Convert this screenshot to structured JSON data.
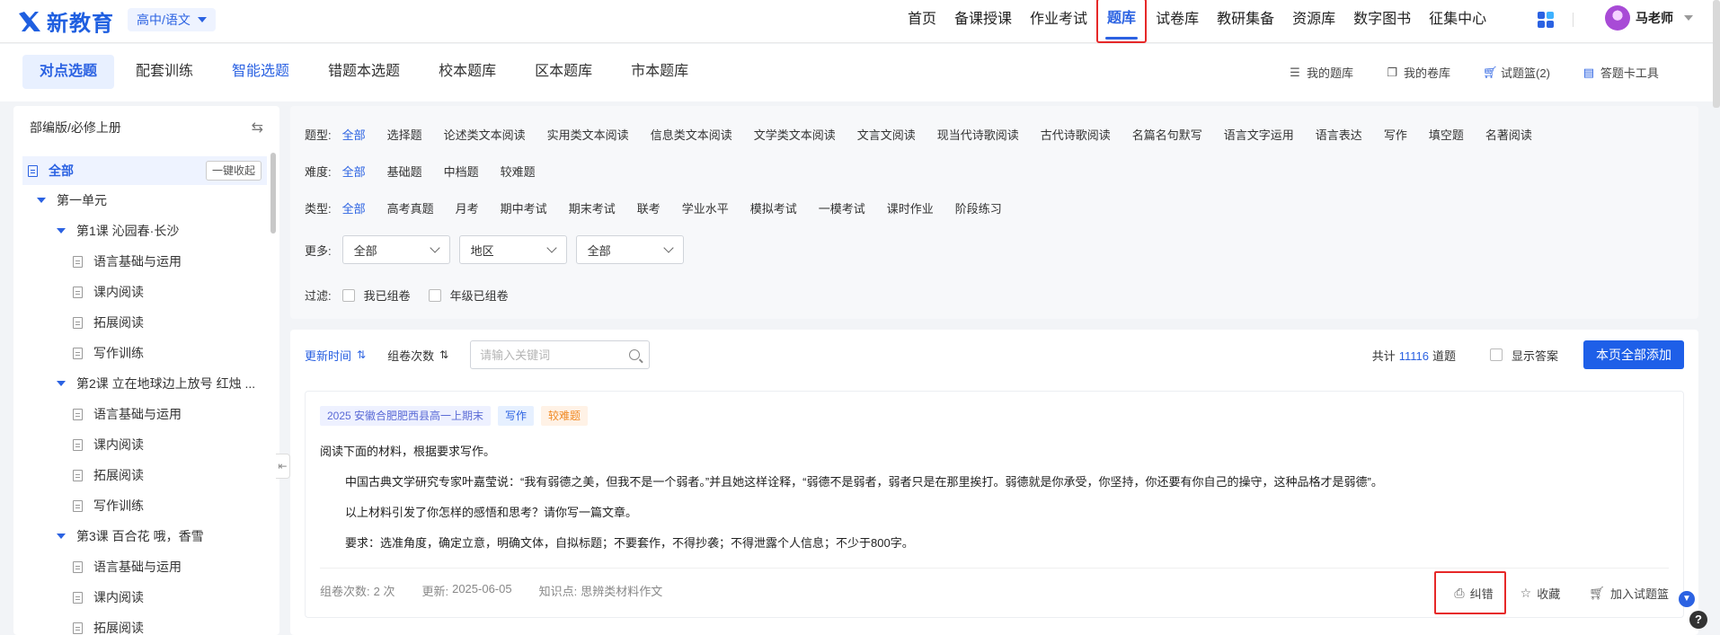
{
  "logo": {
    "text": "新教育"
  },
  "stage": {
    "label": "高中/语文"
  },
  "nav": {
    "items": [
      "首页",
      "备课授课",
      "作业考试",
      "题库",
      "试卷库",
      "教研集备",
      "资源库",
      "数字图书",
      "征集中心"
    ],
    "active_index": 3
  },
  "user": {
    "name": "马老师"
  },
  "subtabs": {
    "items": [
      "对点选题",
      "配套训练",
      "智能选题",
      "错题本选题",
      "校本题库",
      "区本题库",
      "市本题库"
    ],
    "active_index": 0
  },
  "tools": {
    "my_questions": "我的题库",
    "my_papers": "我的卷库",
    "basket": "试题篮(2)",
    "card_tool": "答题卡工具"
  },
  "sidebar": {
    "edition": "部编版/必修上册",
    "all_label": "全部",
    "collapse_all": "一键收起",
    "tree": [
      {
        "level": 0,
        "type": "unit",
        "label": "第一单元"
      },
      {
        "level": 1,
        "type": "lesson",
        "label": "第1课 沁园春·长沙"
      },
      {
        "level": 2,
        "type": "leaf",
        "label": "语言基础与运用"
      },
      {
        "level": 2,
        "type": "leaf",
        "label": "课内阅读"
      },
      {
        "level": 2,
        "type": "leaf",
        "label": "拓展阅读"
      },
      {
        "level": 2,
        "type": "leaf",
        "label": "写作训练"
      },
      {
        "level": 1,
        "type": "lesson",
        "label": "第2课 立在地球边上放号 红烛 ..."
      },
      {
        "level": 2,
        "type": "leaf",
        "label": "语言基础与运用"
      },
      {
        "level": 2,
        "type": "leaf",
        "label": "课内阅读"
      },
      {
        "level": 2,
        "type": "leaf",
        "label": "拓展阅读"
      },
      {
        "level": 2,
        "type": "leaf",
        "label": "写作训练"
      },
      {
        "level": 1,
        "type": "lesson",
        "label": "第3课 百合花 哦，香雪"
      },
      {
        "level": 2,
        "type": "leaf",
        "label": "语言基础与运用"
      },
      {
        "level": 2,
        "type": "leaf",
        "label": "课内阅读"
      },
      {
        "level": 2,
        "type": "leaf",
        "label": "拓展阅读"
      }
    ]
  },
  "filters": {
    "question_type": {
      "label": "题型:",
      "options": [
        "全部",
        "选择题",
        "论述类文本阅读",
        "实用类文本阅读",
        "信息类文本阅读",
        "文学类文本阅读",
        "文言文阅读",
        "现当代诗歌阅读",
        "古代诗歌阅读",
        "名篇名句默写",
        "语言文字运用",
        "语言表达",
        "写作",
        "填空题",
        "名著阅读"
      ],
      "selected": 0
    },
    "difficulty": {
      "label": "难度:",
      "options": [
        "全部",
        "基础题",
        "中档题",
        "较难题"
      ],
      "selected": 0
    },
    "category": {
      "label": "类型:",
      "options": [
        "全部",
        "高考真题",
        "月考",
        "期中考试",
        "期末考试",
        "联考",
        "学业水平",
        "模拟考试",
        "一模考试",
        "课时作业",
        "阶段练习"
      ],
      "selected": 0
    },
    "more": {
      "label": "更多:",
      "selects": [
        "全部",
        "地区",
        "全部"
      ]
    },
    "filter": {
      "label": "过滤:",
      "checks": [
        "我已组卷",
        "年级已组卷"
      ]
    }
  },
  "results": {
    "sort_time": "更新时间",
    "sort_count": "组卷次数",
    "search_placeholder": "请输入关键词",
    "total_prefix": "共计",
    "total_count": "11116",
    "total_suffix": "道题",
    "show_answer": "显示答案",
    "add_all": "本页全部添加"
  },
  "question": {
    "tags": {
      "source": "2025 安徽合肥肥西县高一上期末",
      "kind": "写作",
      "difficulty": "较难题"
    },
    "lines": [
      "阅读下面的材料，根据要求写作。",
      "中国古典文学研究专家叶嘉莹说：“我有弱德之美，但我不是一个弱者。”并且她这样诠释，“弱德不是弱者，弱者只是在那里挨打。弱德就是你承受，你坚持，你还要有你自己的操守，这种品格才是弱德”。",
      "以上材料引发了你怎样的感悟和思考？请你写一篇文章。",
      "要求：选准角度，确定立意，明确文体，自拟标题；不要套作，不得抄袭；不得泄露个人信息；不少于800字。"
    ],
    "meta": {
      "count_label": "组卷次数:",
      "count_value": "2 次",
      "update_label": "更新:",
      "update_value": "2025-06-05",
      "kp_label": "知识点:",
      "kp_value": "思辨类材料作文"
    },
    "actions": {
      "report": "纠错",
      "favorite": "收藏",
      "add_basket": "加入试题篮"
    }
  },
  "colors": {
    "primary": "#2b62e2",
    "highlight": "#e62828"
  }
}
